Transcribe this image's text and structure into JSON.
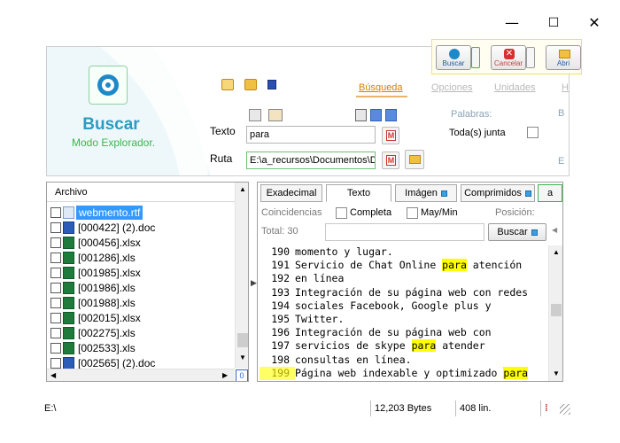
{
  "window": {
    "minimize_icon": "minimize-icon",
    "maximize_icon": "maximize-icon",
    "close_icon": "close-icon"
  },
  "brand": {
    "title": "Buscar",
    "subtitle": "Modo Explorador."
  },
  "ribbon_tabs": [
    {
      "label": "Búsqueda",
      "active": true
    },
    {
      "label": "Opciones",
      "active": false
    },
    {
      "label": "Unidades",
      "active": false
    },
    {
      "label": "Ha",
      "active": false
    }
  ],
  "actions": {
    "buscar": "Buscar",
    "cancelar": "Cancelar",
    "abrir": "Abri"
  },
  "search": {
    "texto_label": "Texto",
    "texto_value": "para",
    "ruta_label": "Ruta",
    "ruta_value": "E:\\a_recursos\\Documentos\\D"
  },
  "palabras": {
    "label": "Palabras:",
    "todas": "Toda(s) junta",
    "side_b": "B",
    "side_e": "E"
  },
  "file_list": {
    "header": "Archivo",
    "items": [
      {
        "name": "webmento.rtf",
        "type": "rtf",
        "selected": true
      },
      {
        "name": "[000422] (2).doc",
        "type": "doc",
        "selected": false
      },
      {
        "name": "[000456].xlsx",
        "type": "xls",
        "selected": false
      },
      {
        "name": "[001286].xls",
        "type": "xls",
        "selected": false
      },
      {
        "name": "[001985].xlsx",
        "type": "xls",
        "selected": false
      },
      {
        "name": "[001986].xls",
        "type": "xls",
        "selected": false
      },
      {
        "name": "[001988].xls",
        "type": "xls",
        "selected": false
      },
      {
        "name": "[002015].xlsx",
        "type": "xls",
        "selected": false
      },
      {
        "name": "[002275].xls",
        "type": "xls",
        "selected": false
      },
      {
        "name": "[002533].xls",
        "type": "xls",
        "selected": false
      },
      {
        "name": "[002565] (2).doc",
        "type": "doc",
        "selected": false
      }
    ],
    "corner_label": "0"
  },
  "viewer": {
    "tabs": [
      {
        "label": "Exadecimal",
        "active": false,
        "square": false
      },
      {
        "label": "Texto",
        "active": true,
        "square": false
      },
      {
        "label": "Imágen",
        "active": false,
        "square": true
      },
      {
        "label": "Comprimidos",
        "active": false,
        "square": true
      },
      {
        "label": "a",
        "active": false,
        "square": false
      }
    ],
    "coincidencias": "Coincidencias",
    "completa": "Completa",
    "maymin": "May/Min",
    "posicion": "Posición:",
    "total": "Total:  30",
    "buscar": "Buscar",
    "lines": [
      {
        "num": "",
        "text": "momento y lugar.",
        "cur": false
      },
      {
        "num": "191",
        "text": "Servicio de Chat Online |para| atención",
        "cur": false
      },
      {
        "num": "192",
        "text": "en línea",
        "cur": false
      },
      {
        "num": "193",
        "text": "Integración de su página web con redes",
        "cur": false
      },
      {
        "num": "194",
        "text": "sociales Facebook, Google plus y",
        "cur": false
      },
      {
        "num": "195",
        "text": "Twitter.",
        "cur": false
      },
      {
        "num": "196",
        "text": "Integración de su página web con",
        "cur": false
      },
      {
        "num": "197",
        "text": "servicios de skype |para| atender",
        "cur": false
      },
      {
        "num": "198",
        "text": "consultas en línea.",
        "cur": false
      },
      {
        "num": "199",
        "text": "Página web indexable y optimizado |para|",
        "cur": true
      }
    ],
    "first_num": "190"
  },
  "status": {
    "path": "E:\\",
    "size": "12,203 Bytes",
    "lines": "408 lin."
  },
  "colors": {
    "accent_blue": "#2e9bc2",
    "accent_green": "#3fb34f",
    "highlight": "#ffff00",
    "tab_active": "#e07b00"
  }
}
